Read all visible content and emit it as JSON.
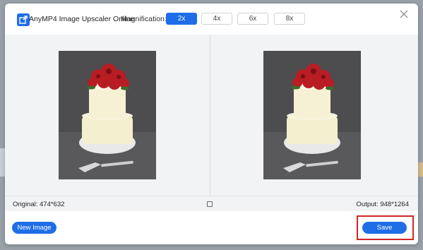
{
  "app": {
    "title": "AnyMP4 Image Upscaler Online",
    "logo_icon": "upscale-arrow-icon",
    "accent_color": "#1f6ee8"
  },
  "magnification": {
    "label": "Magnification:",
    "options": [
      "2x",
      "4x",
      "6x",
      "8x"
    ],
    "selected": "2x"
  },
  "preview": {
    "original_size": "Original: 474*632",
    "output_size": "Output: 948*1264",
    "compare_icon": "compare-square-icon"
  },
  "footer": {
    "new_image_label": "New Image",
    "save_label": "Save",
    "highlight_color": "#d32626"
  },
  "close_icon": "close-icon"
}
